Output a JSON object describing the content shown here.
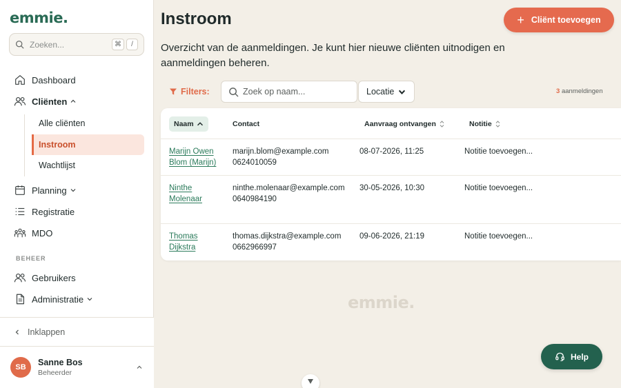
{
  "sidebar": {
    "logo": "emmie.",
    "search": {
      "placeholder": "Zoeken...",
      "kbd1": "⌘",
      "kbd2": "/"
    },
    "items": {
      "dashboard": "Dashboard",
      "clienten": "Cliënten",
      "alle_clienten": "Alle cliënten",
      "instroom": "Instroom",
      "wachtlijst": "Wachtlijst",
      "planning": "Planning",
      "registratie": "Registratie",
      "mdo": "MDO"
    },
    "section_beheer": "BEHEER",
    "beheer_items": {
      "gebruikers": "Gebruikers",
      "administratie": "Administratie"
    },
    "collapse": "Inklappen",
    "user": {
      "initials": "SB",
      "name": "Sanne Bos",
      "role": "Beheerder"
    }
  },
  "main": {
    "title": "Instroom",
    "add_button": "Cliënt toevoegen",
    "description": "Overzicht van de aanmeldingen. Je kunt hier nieuwe cliënten uitnodigen en aanmeldingen beheren.",
    "filters_label": "Filters:",
    "name_search_placeholder": "Zoek op naam...",
    "location_select": "Locatie",
    "count_number": "3",
    "count_label": "aanmeldingen",
    "table": {
      "headers": {
        "naam": "Naam",
        "contact": "Contact",
        "aanvraag": "Aanvraag ontvangen",
        "notitie": "Notitie"
      },
      "rows": [
        {
          "name_l1": "Marijn Owen",
          "name_l2": "Blom (Marijn)",
          "email": "marijn.blom@example.com",
          "phone": "0624010059",
          "date": "08-07-2026, 11:25",
          "note": "Notitie toevoegen..."
        },
        {
          "name_l1": "Ninthe",
          "name_l2": "Molenaar",
          "email": "ninthe.molenaar@example.com",
          "phone": "0640984190",
          "date": "30-05-2026, 10:30",
          "note": "Notitie toevoegen..."
        },
        {
          "name_l1": "Thomas",
          "name_l2": "Dijkstra",
          "email": "thomas.dijkstra@example.com",
          "phone": "0662966997",
          "date": "09-06-2026, 21:19",
          "note": "Notitie toevoegen..."
        }
      ]
    },
    "watermark": "emmie.",
    "help_button": "Help"
  },
  "colors": {
    "brand_green": "#2a6b55",
    "accent_orange": "#e56a4e",
    "help_green": "#23614e",
    "background": "#f3efe7"
  }
}
